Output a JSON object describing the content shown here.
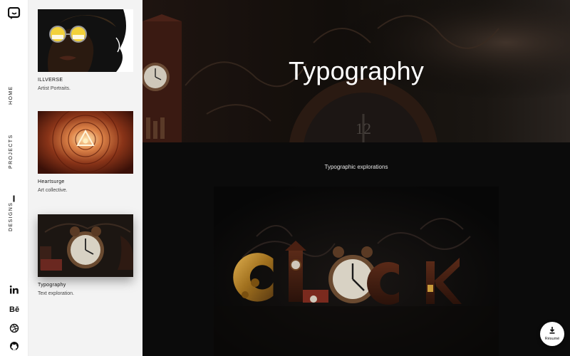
{
  "nav": {
    "home": "HOME",
    "projects": "PROJECTS",
    "designs": "DESIGNS"
  },
  "projects": [
    {
      "title": "ILLVERSE",
      "desc": "Artist Portraits."
    },
    {
      "title": "Heartsurge",
      "desc": "Art collective."
    },
    {
      "title": "Typography",
      "desc": "Text exploration."
    }
  ],
  "main": {
    "hero_title": "Typography",
    "subtitle": "Typographic explorations",
    "clock_numeral": "12"
  },
  "resume": {
    "label": "Résumé"
  },
  "icons": {
    "logo": "chat-bubble-logo-icon",
    "social": [
      "linkedin-icon",
      "behance-icon",
      "dribbble-icon",
      "github-icon"
    ],
    "resume": "download-icon"
  },
  "colors": {
    "accent_copper": "#8a5a32",
    "gold": "#c99a3a"
  }
}
